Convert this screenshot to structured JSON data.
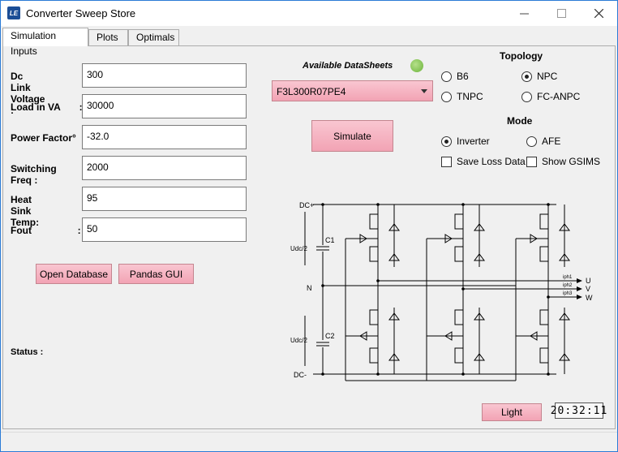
{
  "window": {
    "title": "Converter Sweep Store",
    "icon_text": "LE",
    "controls": [
      "minimize-icon",
      "maximize-icon",
      "close-icon"
    ]
  },
  "tabs": [
    {
      "label": "Simulation Inputs",
      "active": true
    },
    {
      "label": "Plots",
      "active": false
    },
    {
      "label": "Optimals",
      "active": false
    }
  ],
  "inputs": {
    "dc_link_voltage": {
      "label": "Dc Link Voltage :",
      "value": "300"
    },
    "load_in_va": {
      "label": "Load in VA       :",
      "value": "30000"
    },
    "power_factor": {
      "label": "Power Factor°   :",
      "value": "-32.0"
    },
    "switching_freq": {
      "label": "Switching Freq :",
      "value": "2000"
    },
    "heat_sink_temp": {
      "label": "Heat Sink Temp:",
      "value": "95"
    },
    "fout": {
      "label": "Fout                 :",
      "value": "50"
    }
  },
  "buttons": {
    "open_database": "Open Database",
    "pandas_gui": "Pandas GUI",
    "simulate": "Simulate",
    "light": "Light"
  },
  "status_label": "Status :",
  "datasheets": {
    "label": "Available DataSheets",
    "selected": "F3L300R07PE4"
  },
  "topology": {
    "title": "Topology",
    "options": [
      {
        "label": "B6",
        "selected": false
      },
      {
        "label": "NPC",
        "selected": true
      },
      {
        "label": "TNPC",
        "selected": false
      },
      {
        "label": "FC-ANPC",
        "selected": false
      }
    ]
  },
  "mode": {
    "title": "Mode",
    "options": [
      {
        "label": "Inverter",
        "selected": true
      },
      {
        "label": "AFE",
        "selected": false
      }
    ]
  },
  "checkboxes": [
    {
      "label": "Save Loss Data",
      "checked": false
    },
    {
      "label": "Show GSIMS",
      "checked": false
    }
  ],
  "clock": "20:32:11",
  "diagram": {
    "dc_plus": "DC+",
    "dc_minus": "DC-",
    "neutral": "N",
    "c1": "C1",
    "c2": "C2",
    "udc_half": "Udc/2",
    "outputs": [
      "U",
      "V",
      "W"
    ],
    "currents": [
      "iph1",
      "iph2",
      "iph3"
    ]
  }
}
